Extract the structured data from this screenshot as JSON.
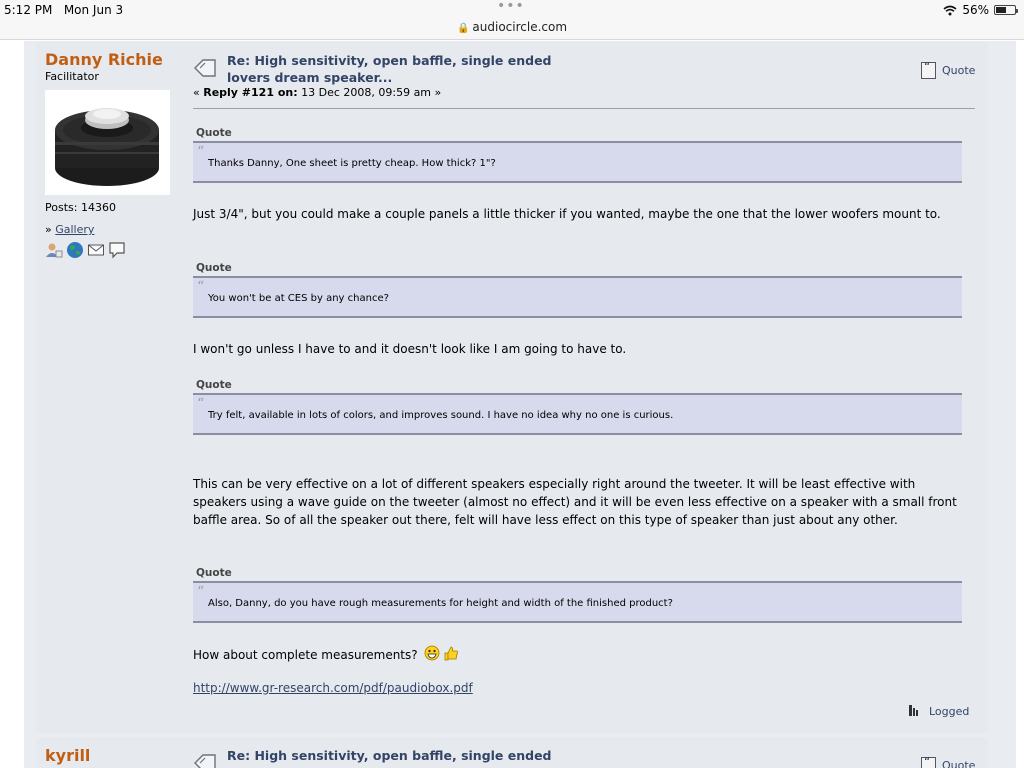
{
  "status_bar": {
    "time": "5:12 PM",
    "date": "Mon Jun 3",
    "url": "audiocircle.com",
    "battery": "56%",
    "battery_level": 0.56,
    "icons": [
      "wifi-icon",
      "battery-icon",
      "lock-icon"
    ]
  },
  "post": {
    "author": "Danny Richie",
    "author_title": "Facilitator",
    "posts_label": "Posts: 14360",
    "gallery_prefix": "»",
    "gallery_label": "Gallery",
    "subject": "Re: High sensitivity, open baffle, single ended lovers dream speaker...",
    "reply_prefix": "«",
    "reply_label": "Reply #121 on:",
    "reply_date": "13 Dec 2008, 09:59 am",
    "reply_suffix": "»",
    "quote_button": "Quote",
    "quote_label": "Quote",
    "quotes": [
      "Thanks Danny, One sheet is pretty cheap. How thick? 1\"?",
      "You won't be at CES by any chance?",
      "Try felt, available in lots of colors, and improves sound. I have no idea why no one is curious.",
      "Also, Danny, do you have rough measurements for height and width of the finished product?"
    ],
    "replies": [
      "Just 3/4\", but you could make a couple panels a little thicker if you wanted, maybe the one that the lower woofers mount to.",
      "I won't go unless I have to and it doesn't look like I am going to have to.",
      "This can be very effective on a lot of different speakers especially right around the tweeter. It will be least effective with speakers using a wave guide on the tweeter (almost no effect) and it will be even less effective on a speaker with a small front baffle area. So of all the speaker out there, felt will have less effect on this type of speaker than just about any other.",
      "How about complete measurements?"
    ],
    "link": "http://www.gr-research.com/pdf/paudiobox.pdf",
    "logged_label": "Logged"
  },
  "next_post": {
    "author": "kyrill",
    "subject": "Re: High sensitivity, open baffle, single ended",
    "quote_button": "Quote"
  },
  "colors": {
    "author": "#c25e12",
    "link": "#334466",
    "quote_bg": "#d7d9ec",
    "post_bg": "#e6eaef"
  }
}
